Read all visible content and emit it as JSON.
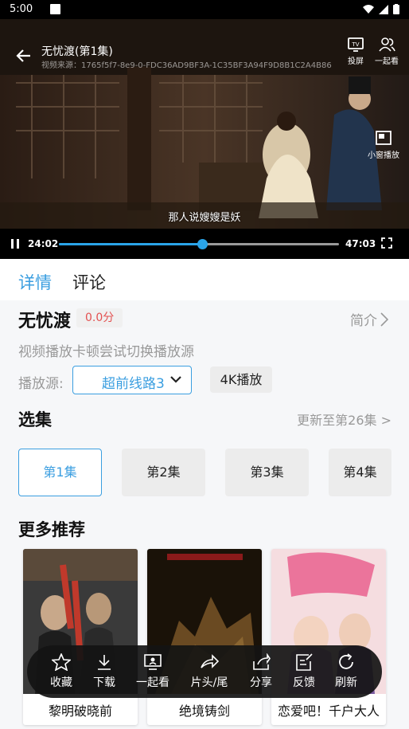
{
  "status_bar": {
    "time": "5:00",
    "icons": [
      "wifi-icon",
      "signal-icon",
      "battery-icon"
    ]
  },
  "player": {
    "title": "无忧渡(第1集)",
    "source_text": "视频来源：1765f5f7-8e9-0-FDC36AD9BF3A-1C35BF3A94F9D8B1C2A4B86",
    "cast_label": "投屏",
    "watch_together_label": "一起看",
    "pip_label": "小窗播放",
    "subtitle": "那人说嫂嫂是妖",
    "current_time": "24:02",
    "total_time": "47:03",
    "progress": 0.51
  },
  "tabs": [
    {
      "label": "详情",
      "active": true
    },
    {
      "label": "评论",
      "active": false
    }
  ],
  "details": {
    "title": "无忧渡",
    "score": "0.0分",
    "intro_label": "简介",
    "hint": "视频播放卡顿尝试切换播放源",
    "source_label": "播放源:",
    "source_value": "超前线路3",
    "k4_label": "4K播放"
  },
  "episodes": {
    "section_title": "选集",
    "update_text": "更新至第26集 >",
    "items": [
      "第1集",
      "第2集",
      "第3集",
      "第4集"
    ],
    "selected": 0
  },
  "recommend": {
    "section_title": "更多推荐",
    "items": [
      "黎明破晓前",
      "绝境铸剑",
      "恋爱吧！千户大人"
    ]
  },
  "actions": [
    {
      "label": "收藏",
      "icon": "star-icon"
    },
    {
      "label": "下载",
      "icon": "download-icon"
    },
    {
      "label": "一起看",
      "icon": "watch-together-icon"
    },
    {
      "label": "片头/尾",
      "icon": "skip-intro-icon"
    },
    {
      "label": "分享",
      "icon": "share-icon"
    },
    {
      "label": "反馈",
      "icon": "feedback-icon"
    },
    {
      "label": "刷新",
      "icon": "refresh-icon"
    }
  ],
  "colors": {
    "accent": "#3a9ee0",
    "progress": "#2aa4e8",
    "score": "#e35050"
  }
}
